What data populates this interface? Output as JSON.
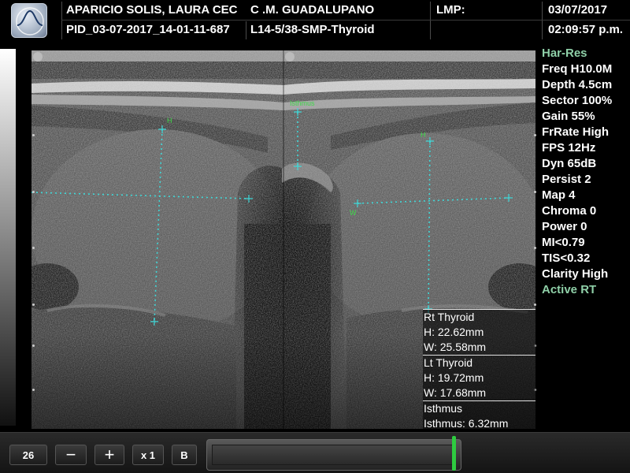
{
  "header": {
    "patient_name": "APARICIO SOLIS, LAURA CEC",
    "institution": "C .M. GUADALUPANO",
    "lmp_label": "LMP:",
    "date": "03/07/2017",
    "patient_id": "PID_03-07-2017_14-01-11-687",
    "probe_preset": "L14-5/38-SMP-Thyroid",
    "time": "02:09:57 p.m."
  },
  "parameters": [
    {
      "label": "Har-Res",
      "accent": true
    },
    {
      "label": "Freq H10.0M",
      "accent": false
    },
    {
      "label": "Depth 4.5cm",
      "accent": false
    },
    {
      "label": "Sector 100%",
      "accent": false
    },
    {
      "label": "Gain 55%",
      "accent": false
    },
    {
      "label": "FrRate High",
      "accent": false
    },
    {
      "label": "FPS 12Hz",
      "accent": false
    },
    {
      "label": "Dyn 65dB",
      "accent": false
    },
    {
      "label": "Persist 2",
      "accent": false
    },
    {
      "label": "Map 4",
      "accent": false
    },
    {
      "label": "Chroma 0",
      "accent": false
    },
    {
      "label": "Power 0",
      "accent": false
    },
    {
      "label": "MI<0.79",
      "accent": false
    },
    {
      "label": "TIS<0.32",
      "accent": false
    },
    {
      "label": "Clarity High",
      "accent": false
    },
    {
      "label": "Active RT",
      "accent": true
    }
  ],
  "measurements": {
    "rt_title": "Rt Thyroid",
    "rt_h": "H: 22.62mm",
    "rt_w": "W: 25.58mm",
    "lt_title": "Lt Thyroid",
    "lt_h": "H: 19.72mm",
    "lt_w": "W: 17.68mm",
    "isthmus_title": "Isthmus",
    "isthmus_val": "Isthmus: 6.32mm"
  },
  "caliper_labels": {
    "left_h": "H",
    "right_h": "H",
    "right_w": "W",
    "isthmus": "Isthmus"
  },
  "toolbar": {
    "zoom_value": "26",
    "minus_label": "−",
    "plus_label": "+",
    "speed_label": "x 1",
    "b_label": "B"
  },
  "colors": {
    "caliper": "#3fd8d8",
    "caliper_label": "#3fd84a",
    "accent_param": "#8fd0a8",
    "cine_marker": "#2ecc40"
  }
}
